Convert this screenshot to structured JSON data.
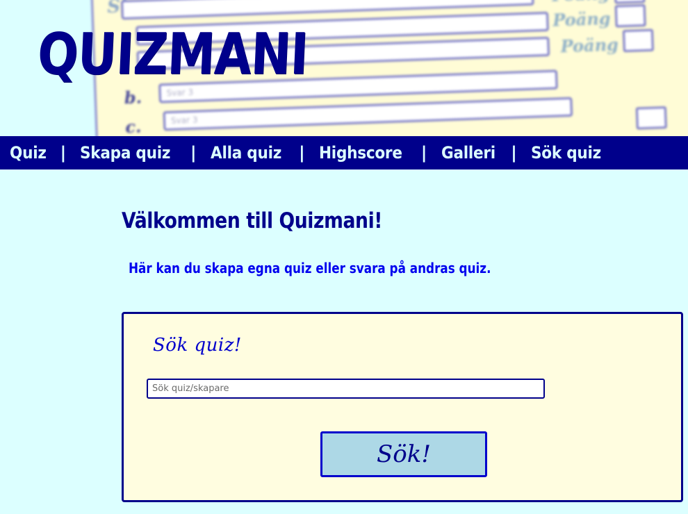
{
  "header": {
    "logo": "QUIZMANI",
    "backdrop": {
      "answer_placeholders": [
        "Svar 3",
        "Svar 3"
      ],
      "points_label": "Poäng"
    }
  },
  "nav": {
    "items": [
      {
        "label": "Quiz"
      },
      {
        "label": "Skapa quiz"
      },
      {
        "label": "Alla quiz"
      },
      {
        "label": "Highscore"
      },
      {
        "label": "Galleri"
      },
      {
        "label": "Sök quiz"
      }
    ],
    "separator": "|"
  },
  "main": {
    "welcome_heading": "Välkommen till Quizmani!",
    "intro_text": "Här kan du skapa egna quiz eller svara på andras quiz.",
    "search": {
      "title": "Sök quiz!",
      "placeholder": "Sök quiz/skapare",
      "value": "",
      "button_label": "Sök!"
    }
  },
  "colors": {
    "page_background": "#dcffff",
    "nav_background": "#00008b",
    "nav_text": "#dcffff",
    "heading": "#00008b",
    "intro_text": "#0000ee",
    "panel_background": "#fffde0",
    "panel_border": "#00008b",
    "button_background": "#add8e6"
  }
}
